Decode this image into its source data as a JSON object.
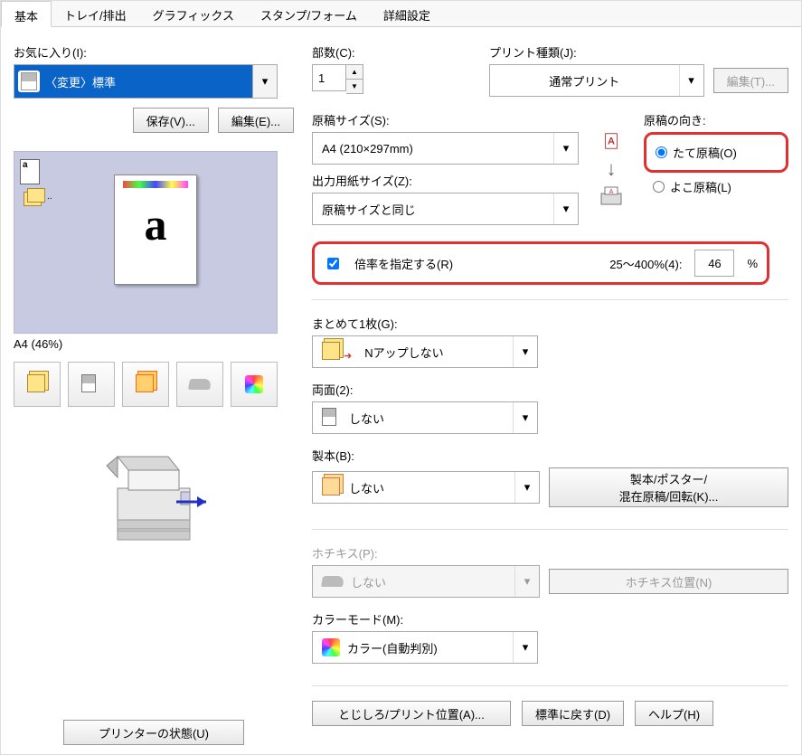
{
  "tabs": {
    "basic": "基本",
    "tray": "トレイ/排出",
    "graphics": "グラフィックス",
    "stamp": "スタンプ/フォーム",
    "advanced": "詳細設定"
  },
  "favorites": {
    "label": "お気に入り(I):",
    "selected": "〈変更〉標準",
    "save_btn": "保存(V)...",
    "edit_btn": "編集(E)..."
  },
  "preview": {
    "caption": "A4 (46%)"
  },
  "copies": {
    "label": "部数(C):",
    "value": "1"
  },
  "print_type": {
    "label": "プリント種類(J):",
    "value": "通常プリント",
    "edit_btn": "編集(T)..."
  },
  "doc_size": {
    "label": "原稿サイズ(S):",
    "value": "A4 (210×297mm)"
  },
  "output_size": {
    "label": "出力用紙サイズ(Z):",
    "value": "原稿サイズと同じ"
  },
  "orientation": {
    "label": "原稿の向き:",
    "portrait": "たて原稿(O)",
    "landscape": "よこ原稿(L)"
  },
  "zoom": {
    "checkbox": "倍率を指定する(R)",
    "range": "25～400%(4):",
    "value": "46",
    "unit": "%"
  },
  "nup": {
    "label": "まとめて1枚(G):",
    "value": "Nアップしない"
  },
  "duplex": {
    "label": "両面(2):",
    "value": "しない"
  },
  "booklet": {
    "label": "製本(B):",
    "value": "しない",
    "button": "製本/ポスター/\n混在原稿/回転(K)..."
  },
  "staple": {
    "label": "ホチキス(P):",
    "value": "しない",
    "button": "ホチキス位置(N)"
  },
  "color": {
    "label": "カラーモード(M):",
    "value": "カラー(自動判別)"
  },
  "footer": {
    "status": "プリンターの状態(U)",
    "margin": "とじしろ/プリント位置(A)...",
    "defaults": "標準に戻す(D)",
    "help": "ヘルプ(H)"
  }
}
